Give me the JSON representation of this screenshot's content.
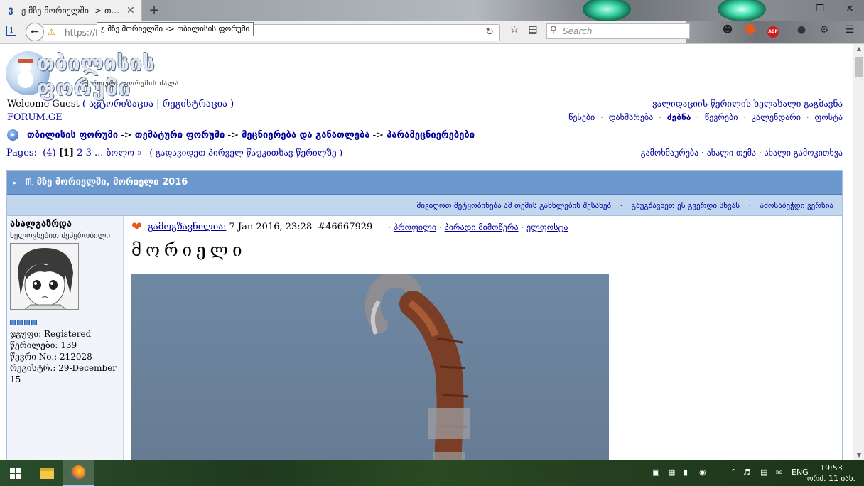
{
  "browser": {
    "tab_title": "ჟ მზე მორიელში -> თ...",
    "tab_close": "✕",
    "new_tab": "+",
    "tooltip": "ჟ მზე მორიელში -> თბილისის ფორუმი",
    "url": "https://f",
    "search_placeholder": "Search",
    "icons": {
      "info": "i",
      "back": "←",
      "reload": "↻"
    }
  },
  "header": {
    "logo_title": "თბილისის ფორუმი",
    "logo_sub": "ქართული ფორუმის ძალა",
    "welcome": "Welcome Guest",
    "open_paren": "(",
    "login": "ავტორიზაცია",
    "pipe": "|",
    "register": "რეგისტრაცია",
    "close_paren": ")",
    "resend_validation": "ვალიდაციის წერილის ხელახალი გაგზავნა",
    "site_name": "FORUM.GE",
    "menu": [
      "წესები",
      "დახმარება",
      "ძებნა",
      "წევრები",
      "კალენდარი",
      "ფოსტა"
    ],
    "menu_sep": "·"
  },
  "breadcrumb": {
    "items": [
      "თბილისის ფორუმი",
      "თემატური ფორუმი",
      "მეცნიერება და განათლება",
      "პარამეცნიერებები"
    ],
    "sep": "->"
  },
  "pagination": {
    "label": "Pages:",
    "count": "(4)",
    "current": "[1]",
    "p2": "2",
    "p3": "3",
    "ellipsis": "...",
    "last": "ბოლო »",
    "first_unread": "( გადავიდეთ პირველ წაუკითხავ წერილზე )"
  },
  "topic_actions": {
    "reply": "გამოხმაურება",
    "new_topic": "ახალი თემა",
    "new_poll": "ახალი გამოკითხვა",
    "sep": "·"
  },
  "topic": {
    "title": "♏ მზე მორიელში, მორიელი 2016",
    "subscribe": "მივიღოთ შეტყობინება ამ თემის განხლების შესახებ",
    "send_page": "გაუგზავნეთ ეს გვერდი სხვას",
    "print": "ამოსაბეჭდი ვერსია",
    "sep": "·"
  },
  "post": {
    "author": "ახალგაზრდა",
    "author_title": "ხელოვნებით შეპყრობილი",
    "group": "ჯგუფი: Registered",
    "posts": "წერილები: 139",
    "member_no": "წევრი No.: 212028",
    "registered": "რეგისტრ.: 29-December 15",
    "posted_label": "გამოგზავნილია:",
    "date": "7 Jan 2016, 23:28",
    "post_id": "#46667929",
    "profile": "პროფილი",
    "pm": "პირადი მიმოწერა",
    "email": "ელფოსტა",
    "link_sep": "·",
    "body_title": "მორიელი"
  },
  "taskbar": {
    "lang": "ENG",
    "time": "19:53",
    "date": "ორშ. 11 იან."
  }
}
